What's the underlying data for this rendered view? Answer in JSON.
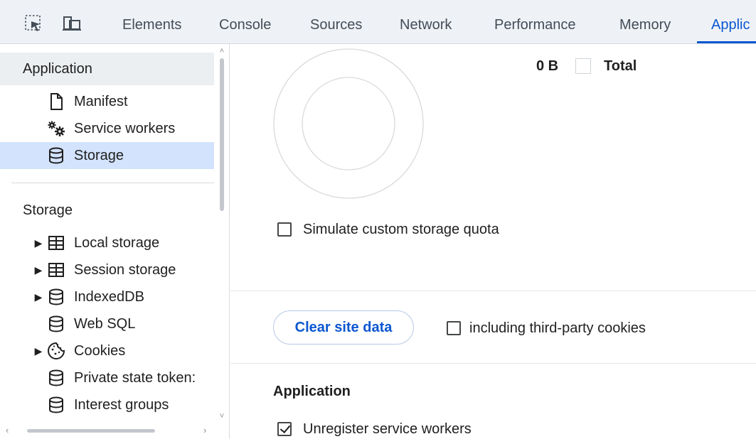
{
  "tabs": [
    {
      "label": "Elements",
      "active": false
    },
    {
      "label": "Console",
      "active": false
    },
    {
      "label": "Sources",
      "active": false
    },
    {
      "label": "Network",
      "active": false
    },
    {
      "label": "Performance",
      "active": false
    },
    {
      "label": "Memory",
      "active": false
    },
    {
      "label": "Applic",
      "active": true
    }
  ],
  "toolbar": {
    "inspect_icon": "select-element-icon",
    "device_icon": "device-toolbar-icon"
  },
  "sidebar": {
    "application_header": "Application",
    "application_items": [
      {
        "label": "Manifest",
        "icon": "file-icon"
      },
      {
        "label": "Service workers",
        "icon": "gears-icon"
      },
      {
        "label": "Storage",
        "icon": "database-icon",
        "selected": true
      }
    ],
    "storage_header": "Storage",
    "storage_items": [
      {
        "label": "Local storage",
        "icon": "table-icon",
        "expandable": true
      },
      {
        "label": "Session storage",
        "icon": "table-icon",
        "expandable": true
      },
      {
        "label": "IndexedDB",
        "icon": "database-icon",
        "expandable": true
      },
      {
        "label": "Web SQL",
        "icon": "database-icon",
        "expandable": false
      },
      {
        "label": "Cookies",
        "icon": "cookie-icon",
        "expandable": true
      },
      {
        "label": "Private state token:",
        "icon": "database-icon",
        "expandable": false
      },
      {
        "label": "Interest groups",
        "icon": "database-icon",
        "expandable": false
      }
    ]
  },
  "main": {
    "usage_value": "0 B",
    "legend_total": "Total",
    "simulate_quota_label": "Simulate custom storage quota",
    "simulate_quota_checked": false,
    "clear_button": "Clear site data",
    "third_party_label": "including third-party cookies",
    "third_party_checked": false,
    "application_section_title": "Application",
    "unregister_label": "Unregister service workers",
    "unregister_checked": true
  },
  "colors": {
    "accent": "#0b57d0",
    "selected_bg": "#d3e3fd",
    "header_bg": "#eceff1"
  }
}
